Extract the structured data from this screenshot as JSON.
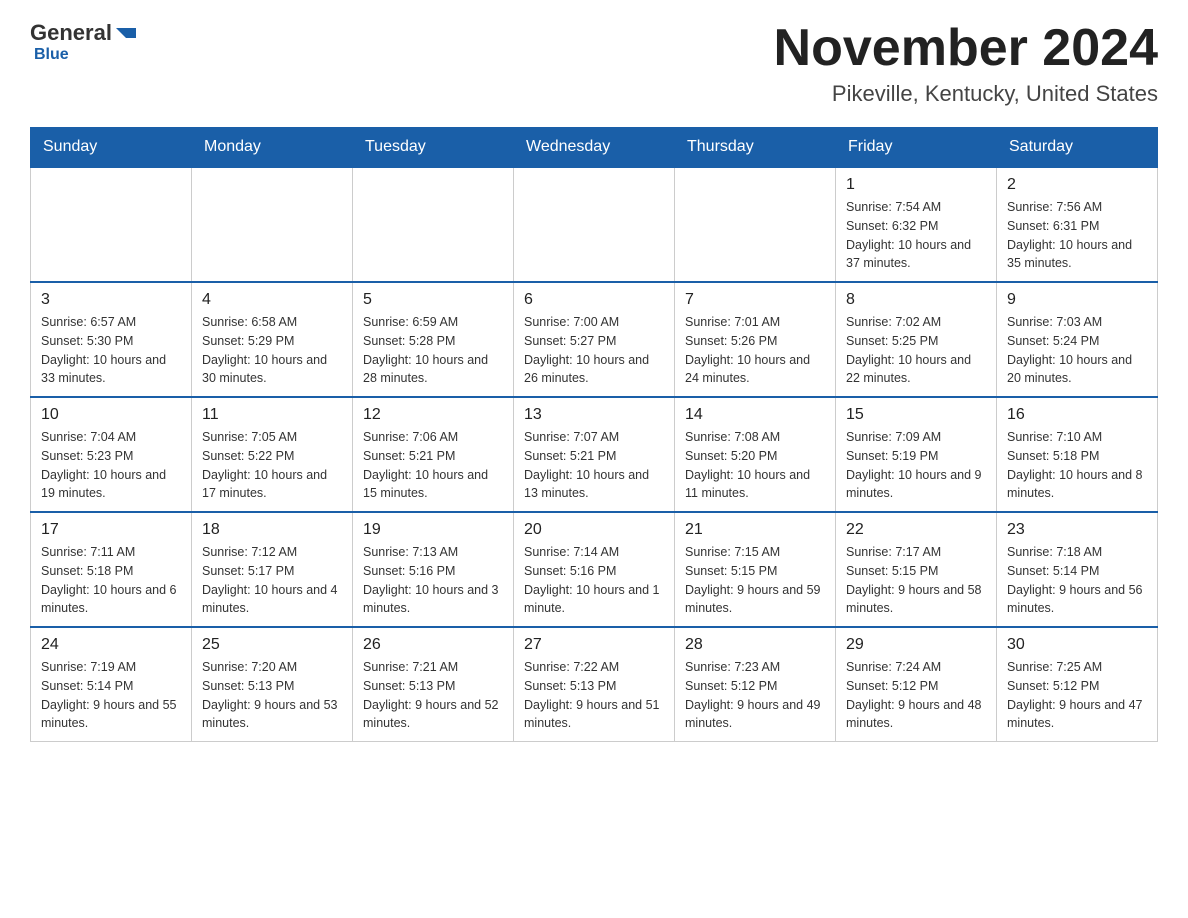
{
  "logo": {
    "general": "General",
    "triangle": "",
    "blue": "Blue"
  },
  "header": {
    "title": "November 2024",
    "subtitle": "Pikeville, Kentucky, United States"
  },
  "weekdays": [
    "Sunday",
    "Monday",
    "Tuesday",
    "Wednesday",
    "Thursday",
    "Friday",
    "Saturday"
  ],
  "weeks": [
    [
      {
        "day": "",
        "info": ""
      },
      {
        "day": "",
        "info": ""
      },
      {
        "day": "",
        "info": ""
      },
      {
        "day": "",
        "info": ""
      },
      {
        "day": "",
        "info": ""
      },
      {
        "day": "1",
        "info": "Sunrise: 7:54 AM\nSunset: 6:32 PM\nDaylight: 10 hours and 37 minutes."
      },
      {
        "day": "2",
        "info": "Sunrise: 7:56 AM\nSunset: 6:31 PM\nDaylight: 10 hours and 35 minutes."
      }
    ],
    [
      {
        "day": "3",
        "info": "Sunrise: 6:57 AM\nSunset: 5:30 PM\nDaylight: 10 hours and 33 minutes."
      },
      {
        "day": "4",
        "info": "Sunrise: 6:58 AM\nSunset: 5:29 PM\nDaylight: 10 hours and 30 minutes."
      },
      {
        "day": "5",
        "info": "Sunrise: 6:59 AM\nSunset: 5:28 PM\nDaylight: 10 hours and 28 minutes."
      },
      {
        "day": "6",
        "info": "Sunrise: 7:00 AM\nSunset: 5:27 PM\nDaylight: 10 hours and 26 minutes."
      },
      {
        "day": "7",
        "info": "Sunrise: 7:01 AM\nSunset: 5:26 PM\nDaylight: 10 hours and 24 minutes."
      },
      {
        "day": "8",
        "info": "Sunrise: 7:02 AM\nSunset: 5:25 PM\nDaylight: 10 hours and 22 minutes."
      },
      {
        "day": "9",
        "info": "Sunrise: 7:03 AM\nSunset: 5:24 PM\nDaylight: 10 hours and 20 minutes."
      }
    ],
    [
      {
        "day": "10",
        "info": "Sunrise: 7:04 AM\nSunset: 5:23 PM\nDaylight: 10 hours and 19 minutes."
      },
      {
        "day": "11",
        "info": "Sunrise: 7:05 AM\nSunset: 5:22 PM\nDaylight: 10 hours and 17 minutes."
      },
      {
        "day": "12",
        "info": "Sunrise: 7:06 AM\nSunset: 5:21 PM\nDaylight: 10 hours and 15 minutes."
      },
      {
        "day": "13",
        "info": "Sunrise: 7:07 AM\nSunset: 5:21 PM\nDaylight: 10 hours and 13 minutes."
      },
      {
        "day": "14",
        "info": "Sunrise: 7:08 AM\nSunset: 5:20 PM\nDaylight: 10 hours and 11 minutes."
      },
      {
        "day": "15",
        "info": "Sunrise: 7:09 AM\nSunset: 5:19 PM\nDaylight: 10 hours and 9 minutes."
      },
      {
        "day": "16",
        "info": "Sunrise: 7:10 AM\nSunset: 5:18 PM\nDaylight: 10 hours and 8 minutes."
      }
    ],
    [
      {
        "day": "17",
        "info": "Sunrise: 7:11 AM\nSunset: 5:18 PM\nDaylight: 10 hours and 6 minutes."
      },
      {
        "day": "18",
        "info": "Sunrise: 7:12 AM\nSunset: 5:17 PM\nDaylight: 10 hours and 4 minutes."
      },
      {
        "day": "19",
        "info": "Sunrise: 7:13 AM\nSunset: 5:16 PM\nDaylight: 10 hours and 3 minutes."
      },
      {
        "day": "20",
        "info": "Sunrise: 7:14 AM\nSunset: 5:16 PM\nDaylight: 10 hours and 1 minute."
      },
      {
        "day": "21",
        "info": "Sunrise: 7:15 AM\nSunset: 5:15 PM\nDaylight: 9 hours and 59 minutes."
      },
      {
        "day": "22",
        "info": "Sunrise: 7:17 AM\nSunset: 5:15 PM\nDaylight: 9 hours and 58 minutes."
      },
      {
        "day": "23",
        "info": "Sunrise: 7:18 AM\nSunset: 5:14 PM\nDaylight: 9 hours and 56 minutes."
      }
    ],
    [
      {
        "day": "24",
        "info": "Sunrise: 7:19 AM\nSunset: 5:14 PM\nDaylight: 9 hours and 55 minutes."
      },
      {
        "day": "25",
        "info": "Sunrise: 7:20 AM\nSunset: 5:13 PM\nDaylight: 9 hours and 53 minutes."
      },
      {
        "day": "26",
        "info": "Sunrise: 7:21 AM\nSunset: 5:13 PM\nDaylight: 9 hours and 52 minutes."
      },
      {
        "day": "27",
        "info": "Sunrise: 7:22 AM\nSunset: 5:13 PM\nDaylight: 9 hours and 51 minutes."
      },
      {
        "day": "28",
        "info": "Sunrise: 7:23 AM\nSunset: 5:12 PM\nDaylight: 9 hours and 49 minutes."
      },
      {
        "day": "29",
        "info": "Sunrise: 7:24 AM\nSunset: 5:12 PM\nDaylight: 9 hours and 48 minutes."
      },
      {
        "day": "30",
        "info": "Sunrise: 7:25 AM\nSunset: 5:12 PM\nDaylight: 9 hours and 47 minutes."
      }
    ]
  ]
}
